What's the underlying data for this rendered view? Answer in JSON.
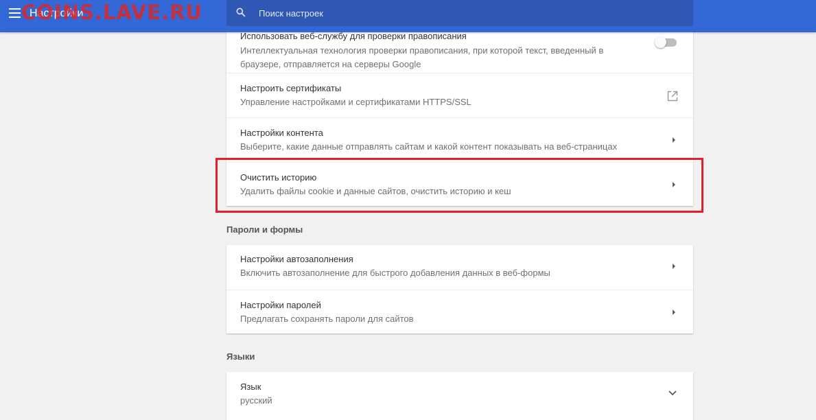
{
  "header": {
    "title": "Настройки",
    "watermark": "COINS.LAVE.RU",
    "menu_icon": "hamburger-menu-icon",
    "search": {
      "placeholder": "Поиск настроек",
      "icon": "search-icon"
    }
  },
  "privacy_card": {
    "spellcheck": {
      "title": "Использовать веб-службу для проверки правописания",
      "description": "Интеллектуальная технология проверки правописания, при которой текст, введенный в браузере, отправляется на серверы Google",
      "toggle_state": "off"
    },
    "certificates": {
      "title": "Настроить сертификаты",
      "description": "Управление настройками и сертификатами HTTPS/SSL",
      "icon": "open-in-new-icon"
    },
    "content_settings": {
      "title": "Настройки контента",
      "description": "Выберите, какие данные отправлять сайтам и какой контент показывать на веб-страницах"
    },
    "clear_history": {
      "title": "Очистить историю",
      "description": "Удалить файлы cookie и данные сайтов, очистить историю и кеш",
      "highlighted": true
    }
  },
  "passwords_section": {
    "title": "Пароли и формы",
    "autofill": {
      "title": "Настройки автозаполнения",
      "description": "Включить автозаполнение для быстрого добавления данных в веб-формы"
    },
    "passwords": {
      "title": "Настройки паролей",
      "description": "Предлагать сохранять пароли для сайтов"
    }
  },
  "languages_section": {
    "title": "Языки",
    "language": {
      "title": "Язык",
      "value": "русский",
      "icon": "chevron-down-icon"
    }
  },
  "colors": {
    "header_bg": "#3367d6",
    "search_bg": "#2f58b5",
    "highlight_border": "#e0202a",
    "watermark": "#dc2828",
    "page_bg": "#f1f1f1"
  }
}
